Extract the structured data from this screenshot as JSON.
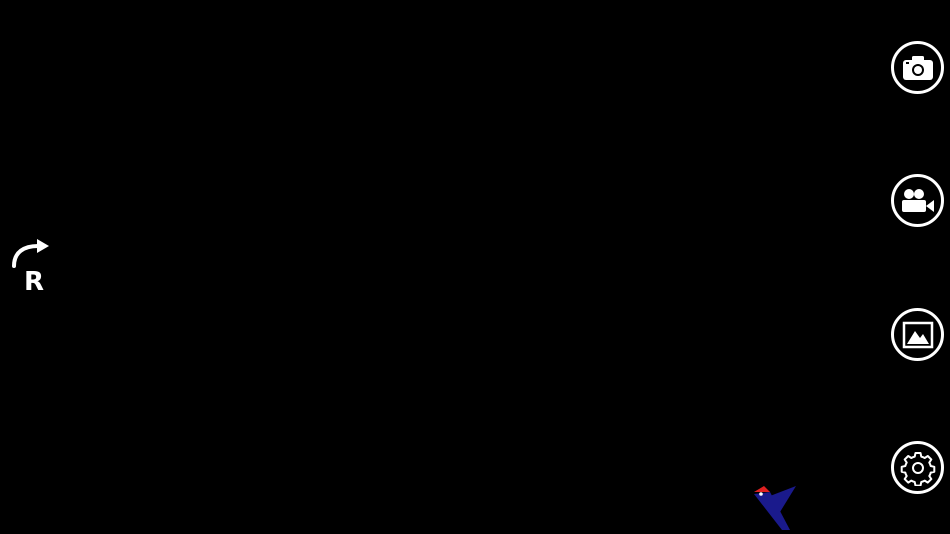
{
  "controls": {
    "rotate": {
      "letter": "R",
      "icon": "rotate-arrow-icon"
    },
    "photo": {
      "icon": "camera-icon"
    },
    "video": {
      "icon": "video-camera-icon"
    },
    "gallery": {
      "icon": "image-gallery-icon"
    },
    "settings": {
      "icon": "gear-icon"
    }
  },
  "colors": {
    "background": "#000000",
    "foreground": "#ffffff",
    "logo_blue": "#1a1a8c",
    "logo_red": "#e02020"
  }
}
